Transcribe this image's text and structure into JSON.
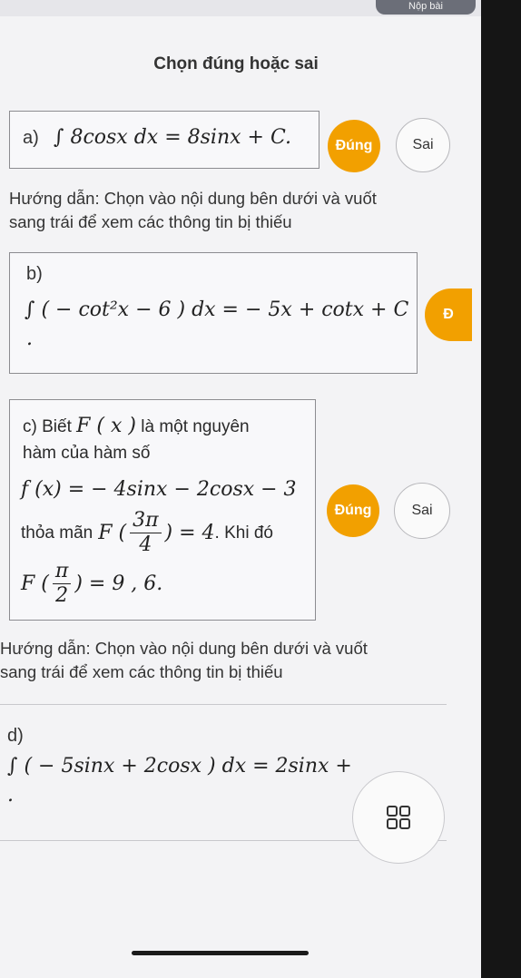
{
  "header": {
    "title": "Chọn đúng hoặc sai",
    "top_button": "Nộp bài"
  },
  "questions": {
    "a": {
      "label": "a)",
      "formula": "∫ 8cosx dx = 8sinx + C.",
      "dung": "Đúng",
      "sai": "Sai"
    },
    "b": {
      "label": "b)",
      "formula": "∫ ( − cot²x − 6 ) dx = − 5x + cotx + C",
      "tail": ".",
      "dung": "Đ"
    },
    "c": {
      "label": "c)",
      "text1": "Biết",
      "fx": "F ( x )",
      "text2": "là một nguyên",
      "line2": "hàm của hàm số",
      "formula": "f (x) = − 4sinx − 2cosx − 3",
      "cond_prefix": "thỏa mãn",
      "cond_F": "F (",
      "cond_num": "3π",
      "cond_den": "4",
      "cond_suffix": ") = 4",
      "cond_tail": ". Khi đó",
      "res_F": "F (",
      "res_num": "π",
      "res_den": "2",
      "res_suffix": ") = 9 , 6.",
      "dung": "Đúng",
      "sai": "Sai"
    },
    "d": {
      "label": "d)",
      "formula": "∫ ( − 5sinx + 2cosx ) dx = 2sinx +",
      "tail": "."
    }
  },
  "hint": {
    "line1": "Hướng dẫn: Chọn vào nội dung bên dưới và vuốt",
    "line2": "sang trái để xem các thông tin bị thiếu"
  },
  "colors": {
    "accent": "#f2a000"
  },
  "icons": {
    "grid": "grid-icon"
  }
}
